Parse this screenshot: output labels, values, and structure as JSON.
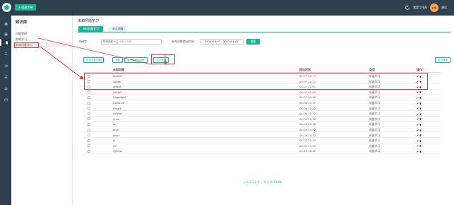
{
  "topbar": {
    "create_label": "+ 创建工单",
    "workbench_label": "我是工作台",
    "avatar_text": "在线",
    "username": "测试",
    "bg_color": "#2f4050",
    "accent_color": "#1ab394"
  },
  "rail": {
    "icons": [
      "home-icon",
      "list-icon",
      "doc-icon",
      "user-icon",
      "chart-icon",
      "people-icon",
      "gear-icon",
      "mail-icon"
    ]
  },
  "submenu": {
    "title": "知识库",
    "items": [
      {
        "label": "问题管理"
      },
      {
        "label": "智能学习"
      },
      {
        "label": "未知问题学习"
      }
    ]
  },
  "main": {
    "title": "未知问题学习",
    "tabs": [
      {
        "label": "未知问题学习"
      },
      {
        "label": "永久忽略"
      }
    ],
    "filters": {
      "keyword_label": "关键字：",
      "select_value": "所有类型",
      "keyword_placeholder": "请输入问题",
      "date_label": "未知问题提出时间：",
      "date_value": "2017-03-07 - 2017-04-07",
      "search_label": "搜索"
    },
    "actions": [
      {
        "label": "添加为新问题"
      },
      {
        "label": "忽略"
      },
      {
        "label": "学习到相似问题"
      },
      {
        "label": "永久忽略"
      }
    ],
    "export_label": "导出数据",
    "columns": [
      "未知问题",
      "提出时间",
      "类型",
      "操作"
    ],
    "rows": [
      {
        "q": "dahdsf",
        "t": "04-07 11:11",
        "type": "机器学习",
        "checked": true
      },
      {
        "q": "sdfdsf",
        "t": "04-07 11:11",
        "type": "机器学习",
        "checked": false
      },
      {
        "q": "gffdgf",
        "t": "04-07 11:01",
        "type": "机器学习",
        "checked": false
      },
      {
        "q": "sdhgfh",
        "t": "04-07 11:05",
        "type": "机器学习",
        "checked": false
      },
      {
        "q": "fdsgfdgfd",
        "t": "04-07 10:58",
        "type": "机器学习",
        "checked": false
      },
      {
        "q": "asdfasdf",
        "t": "04-06 15:41",
        "type": "机器学习",
        "checked": false
      },
      {
        "q": "fhxgfk",
        "t": "04-06 11:22",
        "type": "机器学习",
        "checked": false
      },
      {
        "q": "zxfvfxf",
        "t": "04-06 11:22",
        "type": "机器学习",
        "checked": false
      },
      {
        "q": "jhkm,",
        "t": "04-05 15:18",
        "type": "机器学习",
        "checked": false
      },
      {
        "q": "kk,",
        "t": "04-05 15:18",
        "type": "机器学习",
        "checked": false
      },
      {
        "q": "ghjk",
        "t": "04-05 13:42",
        "type": "机器学习",
        "checked": false
      },
      {
        "q": "ghjkl",
        "t": "04-05 13:42",
        "type": "机器学习",
        "checked": false
      },
      {
        "q": "jjj",
        "t": "04-01 11:34",
        "type": "机器学习",
        "checked": false
      },
      {
        "q": "jkk",
        "t": "04-01 11:34",
        "type": "机器学习",
        "checked": false
      },
      {
        "q": "fgjhfgn",
        "t": "03-29 16:02",
        "type": "机器学习",
        "checked": false
      }
    ],
    "pagination": "< 1 2 3 4 5 ... 9 > 共 124条"
  }
}
